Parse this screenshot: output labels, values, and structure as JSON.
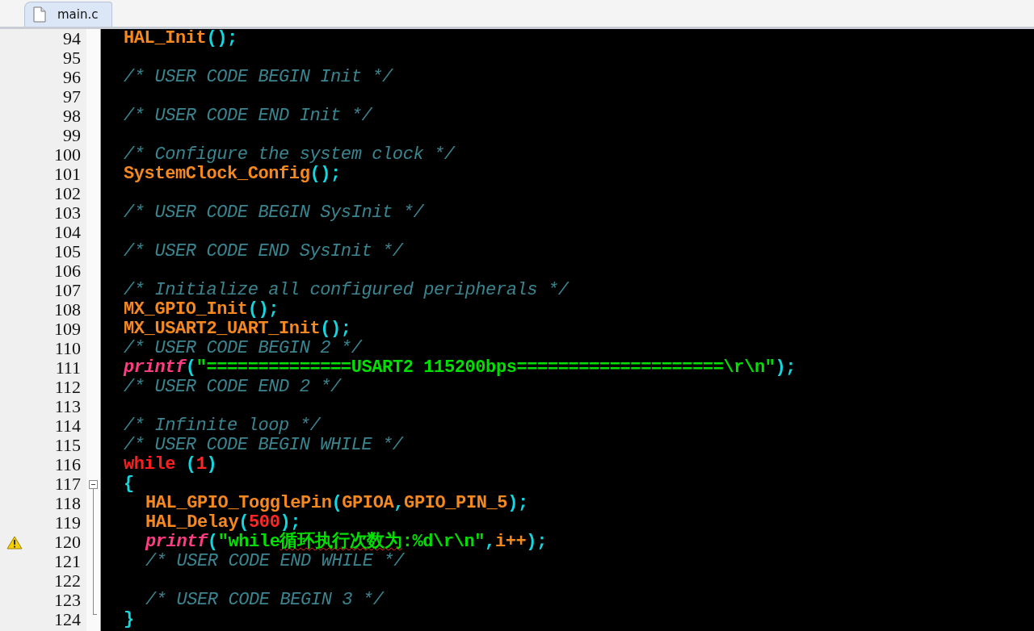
{
  "tab": {
    "title": "main.c",
    "selected": true
  },
  "editor": {
    "lines": [
      {
        "number": "94",
        "tokens": [
          {
            "kind": "func",
            "text": "HAL_Init"
          },
          {
            "kind": "punct",
            "text": "();"
          }
        ]
      },
      {
        "number": "95"
      },
      {
        "number": "96",
        "tokens": [
          {
            "kind": "comment",
            "text": "/* USER CODE BEGIN Init */"
          }
        ]
      },
      {
        "number": "97"
      },
      {
        "number": "98",
        "tokens": [
          {
            "kind": "comment",
            "text": "/* USER CODE END Init */"
          }
        ]
      },
      {
        "number": "99"
      },
      {
        "number": "100",
        "tokens": [
          {
            "kind": "comment",
            "text": "/* Configure the system clock */"
          }
        ]
      },
      {
        "number": "101",
        "tokens": [
          {
            "kind": "func",
            "text": "SystemClock_Config"
          },
          {
            "kind": "punct",
            "text": "();"
          }
        ]
      },
      {
        "number": "102"
      },
      {
        "number": "103",
        "tokens": [
          {
            "kind": "comment",
            "text": "/* USER CODE BEGIN SysInit */"
          }
        ]
      },
      {
        "number": "104"
      },
      {
        "number": "105",
        "tokens": [
          {
            "kind": "comment",
            "text": "/* USER CODE END SysInit */"
          }
        ]
      },
      {
        "number": "106"
      },
      {
        "number": "107",
        "tokens": [
          {
            "kind": "comment",
            "text": "/* Initialize all configured peripherals */"
          }
        ]
      },
      {
        "number": "108",
        "tokens": [
          {
            "kind": "func",
            "text": "MX_GPIO_Init"
          },
          {
            "kind": "punct",
            "text": "();"
          }
        ]
      },
      {
        "number": "109",
        "tokens": [
          {
            "kind": "func",
            "text": "MX_USART2_UART_Init"
          },
          {
            "kind": "punct",
            "text": "();"
          }
        ]
      },
      {
        "number": "110",
        "tokens": [
          {
            "kind": "comment",
            "text": "/* USER CODE BEGIN 2 */"
          }
        ]
      },
      {
        "number": "111",
        "tokens": [
          {
            "kind": "libfunc",
            "text": "printf"
          },
          {
            "kind": "punct",
            "text": "("
          },
          {
            "kind": "string",
            "text": "\"==============USART2 115200bps====================\\r\\n\""
          },
          {
            "kind": "punct",
            "text": ");"
          }
        ]
      },
      {
        "number": "112",
        "tokens": [
          {
            "kind": "comment",
            "text": "/* USER CODE END 2 */"
          }
        ]
      },
      {
        "number": "113"
      },
      {
        "number": "114",
        "tokens": [
          {
            "kind": "comment",
            "text": "/* Infinite loop */"
          }
        ]
      },
      {
        "number": "115",
        "tokens": [
          {
            "kind": "comment",
            "text": "/* USER CODE BEGIN WHILE */"
          }
        ]
      },
      {
        "number": "116",
        "tokens": [
          {
            "kind": "keyword",
            "text": "while"
          },
          {
            "kind": "punct",
            "text": " ("
          },
          {
            "kind": "number",
            "text": "1"
          },
          {
            "kind": "punct",
            "text": ")"
          }
        ]
      },
      {
        "number": "117",
        "expanded": true,
        "tokens": [
          {
            "kind": "punct",
            "text": "{"
          }
        ],
        "children": [
          {
            "number": "118",
            "tokens": [
              {
                "kind": "func",
                "text": "HAL_GPIO_TogglePin"
              },
              {
                "kind": "punct",
                "text": "("
              },
              {
                "kind": "func",
                "text": "GPIOA"
              },
              {
                "kind": "punct",
                "text": ","
              },
              {
                "kind": "func",
                "text": "GPIO_PIN_5"
              },
              {
                "kind": "punct",
                "text": ");"
              }
            ]
          },
          {
            "number": "119",
            "tokens": [
              {
                "kind": "func",
                "text": "HAL_Delay"
              },
              {
                "kind": "punct",
                "text": "("
              },
              {
                "kind": "number",
                "text": "500"
              },
              {
                "kind": "punct",
                "text": ");"
              }
            ]
          },
          {
            "number": "120",
            "warning": true,
            "tokens": [
              {
                "kind": "libfunc",
                "text": "printf"
              },
              {
                "kind": "punct",
                "text": "("
              },
              {
                "kind": "string",
                "text": "\"while"
              },
              {
                "kind": "string",
                "text": "循环执行次数为",
                "squiggle": true
              },
              {
                "kind": "string",
                "text": ":%d\\r\\n\""
              },
              {
                "kind": "punct",
                "text": ","
              },
              {
                "kind": "func",
                "text": "i++"
              },
              {
                "kind": "punct",
                "text": ");"
              }
            ]
          },
          {
            "number": "121",
            "tokens": [
              {
                "kind": "comment",
                "text": "/* USER CODE END WHILE */"
              }
            ]
          },
          {
            "number": "122"
          },
          {
            "number": "123",
            "tokens": [
              {
                "kind": "comment",
                "text": "/* USER CODE BEGIN 3 */"
              }
            ]
          }
        ]
      },
      {
        "number": "124",
        "tokens": [
          {
            "kind": "punct",
            "text": "}"
          }
        ]
      }
    ]
  }
}
